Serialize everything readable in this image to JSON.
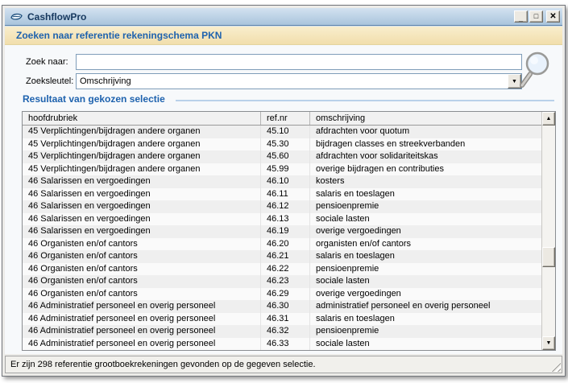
{
  "window": {
    "title": "CashflowPro",
    "minimize_glyph": "_",
    "maximize_glyph": "□",
    "close_glyph": "✕"
  },
  "app_header": {
    "title": "Zoeken naar referentie rekeningschema PKN"
  },
  "search": {
    "term_label": "Zoek naar:",
    "term_value": "",
    "key_label": "Zoeksleutel:",
    "key_value": "Omschrijving",
    "dropdown_arrow_glyph": "▼"
  },
  "results": {
    "section_title": "Resultaat van gekozen selectie",
    "columns": {
      "hoofdrubriek": "hoofdrubriek",
      "refnr": "ref.nr",
      "omschrijving": "omschrijving"
    },
    "rows": [
      {
        "hoofdrubriek": "45 Verplichtingen/bijdragen andere organen",
        "refnr": "45.10",
        "omschrijving": "afdrachten voor quotum"
      },
      {
        "hoofdrubriek": "45 Verplichtingen/bijdragen andere organen",
        "refnr": "45.30",
        "omschrijving": "bijdragen classes en streekverbanden"
      },
      {
        "hoofdrubriek": "45 Verplichtingen/bijdragen andere organen",
        "refnr": "45.60",
        "omschrijving": "afdrachten voor solidariteitskas"
      },
      {
        "hoofdrubriek": "45 Verplichtingen/bijdragen andere organen",
        "refnr": "45.99",
        "omschrijving": "overige bijdragen en contributies"
      },
      {
        "hoofdrubriek": "46 Salarissen en vergoedingen",
        "refnr": "46.10",
        "omschrijving": "kosters"
      },
      {
        "hoofdrubriek": "46 Salarissen en vergoedingen",
        "refnr": "46.11",
        "omschrijving": "salaris en toeslagen"
      },
      {
        "hoofdrubriek": "46 Salarissen en vergoedingen",
        "refnr": "46.12",
        "omschrijving": "pensioenpremie"
      },
      {
        "hoofdrubriek": "46 Salarissen en vergoedingen",
        "refnr": "46.13",
        "omschrijving": "sociale lasten"
      },
      {
        "hoofdrubriek": "46 Salarissen en vergoedingen",
        "refnr": "46.19",
        "omschrijving": "overige vergoedingen"
      },
      {
        "hoofdrubriek": "46 Organisten en/of cantors",
        "refnr": "46.20",
        "omschrijving": "organisten en/of cantors"
      },
      {
        "hoofdrubriek": "46 Organisten en/of cantors",
        "refnr": "46.21",
        "omschrijving": "salaris en toeslagen"
      },
      {
        "hoofdrubriek": "46 Organisten en/of cantors",
        "refnr": "46.22",
        "omschrijving": "pensioenpremie"
      },
      {
        "hoofdrubriek": "46 Organisten en/of cantors",
        "refnr": "46.23",
        "omschrijving": "sociale lasten"
      },
      {
        "hoofdrubriek": "46 Organisten en/of cantors",
        "refnr": "46.29",
        "omschrijving": "overige vergoedingen"
      },
      {
        "hoofdrubriek": "46 Administratief personeel en overig personeel",
        "refnr": "46.30",
        "omschrijving": "administratief personeel en overig personeel"
      },
      {
        "hoofdrubriek": "46 Administratief personeel en overig personeel",
        "refnr": "46.31",
        "omschrijving": "salaris en toeslagen"
      },
      {
        "hoofdrubriek": "46 Administratief personeel en overig personeel",
        "refnr": "46.32",
        "omschrijving": "pensioenpremie"
      },
      {
        "hoofdrubriek": "46 Administratief personeel en overig personeel",
        "refnr": "46.33",
        "omschrijving": "sociale lasten"
      }
    ],
    "scrollbar": {
      "up_glyph": "▲",
      "down_glyph": "▼"
    }
  },
  "status_bar": {
    "text": "Er zijn 298 referentie grootboekrekeningen gevonden op de gegeven selectie."
  },
  "colors": {
    "titlebar_gradient_top": "#d3e2f1",
    "titlebar_gradient_bottom": "#a9c4dc",
    "title_text": "#16385e",
    "header_background": "#f6e8c2",
    "header_text": "#1e62ae",
    "section_title_text": "#1e62ae",
    "section_line": "#b9d1ea",
    "input_border": "#7f9db9",
    "table_border": "#8a8d91",
    "row_alt": "#efefef",
    "row_base": "#fafafa"
  }
}
